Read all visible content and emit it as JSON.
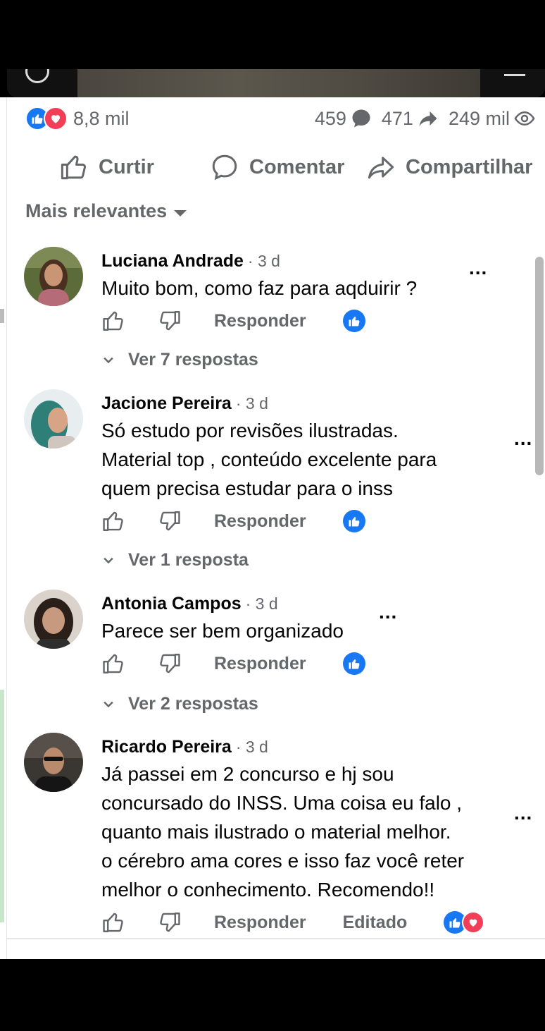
{
  "post": {
    "reactions_count": "8,8 mil",
    "comments_count": "459",
    "shares_count": "471",
    "views_count": "249 mil",
    "reaction_types": [
      "like-icon",
      "love-icon"
    ],
    "colors": {
      "like_blue": "#1877f2",
      "love_red": "#f33e58",
      "meta_gray": "#65676b"
    }
  },
  "actions": {
    "like_label": "Curtir",
    "comment_label": "Comentar",
    "share_label": "Compartilhar"
  },
  "sort": {
    "label": "Mais relevantes"
  },
  "comments": [
    {
      "author": "Luciana Andrade",
      "time": "· 3 d",
      "lines": [
        "Muito bom, como faz para aqduirir ?"
      ],
      "reply_label": "Responder",
      "replies_label": "Ver 7 respostas",
      "more": "..."
    },
    {
      "author": "Jacione Pereira",
      "time": "· 3 d",
      "lines": [
        "Só estudo por revisões ilustradas.",
        "Material top , conteúdo excelente para",
        "quem precisa estudar para o inss"
      ],
      "reply_label": "Responder",
      "replies_label": "Ver 1 resposta",
      "more": "..."
    },
    {
      "author": "Antonia Campos",
      "time": "· 3 d",
      "lines": [
        "Parece ser bem organizado"
      ],
      "reply_label": "Responder",
      "replies_label": "Ver 2 respostas",
      "more": "..."
    },
    {
      "author": "Ricardo Pereira",
      "time": "· 3 d",
      "lines": [
        "Já passei em 2 concurso e hj sou",
        "concursado do INSS. Uma coisa eu falo ,",
        "quanto mais ilustrado o material melhor.",
        "o cérebro ama cores e isso faz você reter",
        "melhor o conhecimento. Recomendo!!"
      ],
      "reply_label": "Responder",
      "edited_label": "Editado",
      "more": "..."
    }
  ]
}
